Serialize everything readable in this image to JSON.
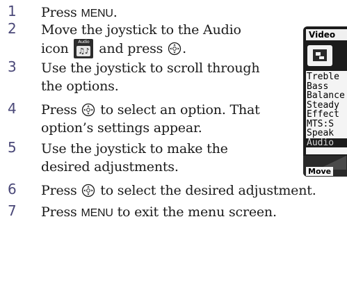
{
  "steps": [
    {
      "num": "1",
      "lines": [
        {
          "a": "Press ",
          "b": "MENU",
          "c": "."
        }
      ]
    },
    {
      "num": "2",
      "line1": "Move the joystick to the Audio",
      "line2_pre": "icon ",
      "line2_post": " and press ",
      "line2_end": "."
    },
    {
      "num": "3",
      "line1": "Use the joystick to scroll through",
      "line2": "the options."
    },
    {
      "num": "4",
      "line1_pre": "Press ",
      "line1_post": " to select an option. That",
      "line2": "option’s settings appear."
    },
    {
      "num": "5",
      "line1": "Use the joystick to make the",
      "line2": "desired adjustments."
    },
    {
      "num": "6",
      "pre": "Press ",
      "post": " to select the desired adjustment."
    },
    {
      "num": "7",
      "a": "Press ",
      "b": "MENU",
      "c": " to exit the menu screen."
    }
  ],
  "icons": {
    "audio_icon_label": "Audio",
    "audio_icon_glyph": "♫♪",
    "enter_button": "enter-button-icon"
  },
  "screen": {
    "tab_label": "Video",
    "items": [
      "Treble",
      "Bass",
      "Balance",
      "Steady",
      "Effect",
      "MTS:S",
      "Speak",
      "Audio"
    ],
    "footer": "Move"
  }
}
